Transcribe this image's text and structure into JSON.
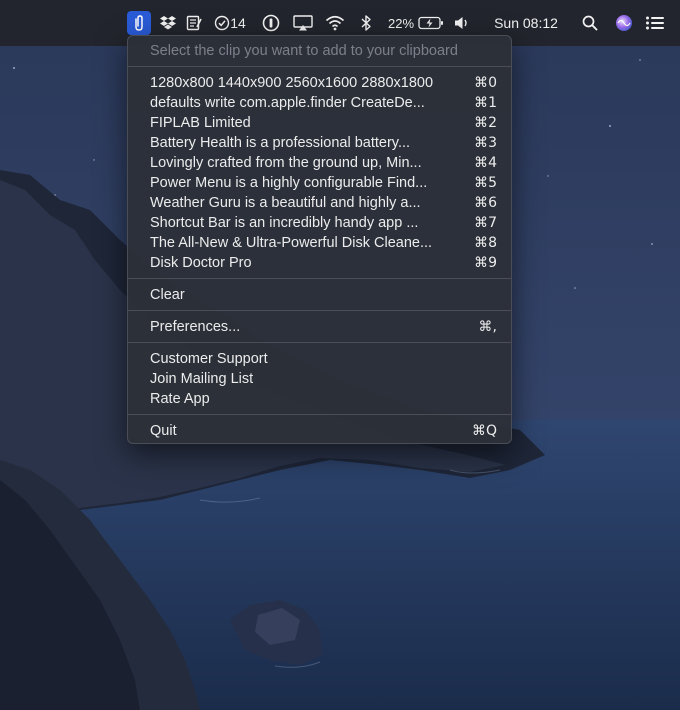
{
  "menubar": {
    "battery_percent": "22%",
    "clock": "Sun 08:12",
    "tasks_count": "14",
    "icons": [
      "paperclip-icon",
      "dropbox-icon",
      "notes-icon",
      "checkmark-circle-icon",
      "onepassword-icon",
      "airplay-icon",
      "wifi-icon",
      "bluetooth-icon",
      "battery-icon",
      "volume-icon",
      "search-icon",
      "siri-icon",
      "list-icon"
    ]
  },
  "menu": {
    "header": "Select the clip you want to add to your clipboard",
    "clips": [
      {
        "label": "1280x800 1440x900 2560x1600 2880x1800",
        "shortcut": "⌘0"
      },
      {
        "label": "defaults write com.apple.finder CreateDe...",
        "shortcut": "⌘1"
      },
      {
        "label": "FIPLAB Limited",
        "shortcut": "⌘2"
      },
      {
        "label": "Battery Health is a professional battery...",
        "shortcut": "⌘3"
      },
      {
        "label": "Lovingly crafted from the ground up, Min...",
        "shortcut": "⌘4"
      },
      {
        "label": "Power Menu is a highly configurable Find...",
        "shortcut": "⌘5"
      },
      {
        "label": "Weather Guru is a beautiful and highly a...",
        "shortcut": "⌘6"
      },
      {
        "label": "Shortcut Bar is an incredibly handy app ...",
        "shortcut": "⌘7"
      },
      {
        "label": "The All-New & Ultra-Powerful Disk Cleane...",
        "shortcut": "⌘8"
      },
      {
        "label": "Disk Doctor Pro",
        "shortcut": "⌘9"
      }
    ],
    "clear": "Clear",
    "preferences": {
      "label": "Preferences...",
      "shortcut": "⌘,"
    },
    "support": [
      "Customer Support",
      "Join Mailing List",
      "Rate App"
    ],
    "quit": {
      "label": "Quit",
      "shortcut": "⌘Q"
    }
  },
  "colors": {
    "menubar_bg": "#22252d",
    "active_item": "#2a5bd7",
    "menu_bg": "#2c3038",
    "header_text": "#7d8089"
  }
}
